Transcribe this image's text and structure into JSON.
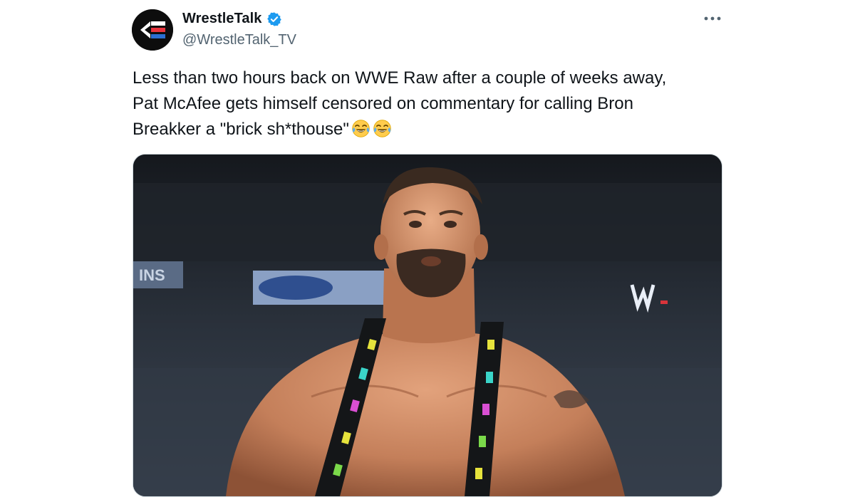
{
  "tweet": {
    "author": {
      "display_name": "WrestleTalk",
      "handle": "@WrestleTalk_TV",
      "verified": true,
      "avatar_icon": "wrestletalk-logo-icon",
      "verified_icon": "verified-badge-icon"
    },
    "more_icon": "more-options-icon",
    "text_lines": [
      "Less than two hours back on WWE Raw after a couple of weeks away,",
      "Pat McAfee gets himself censored on commentary for calling Bron",
      "Breakker a \"brick sh*thouse\""
    ],
    "emojis": [
      "face-with-tears-of-joy-icon",
      "face-with-tears-of-joy-icon"
    ],
    "media": {
      "type": "image",
      "icon": "wrestler-photo",
      "arena_sign_text": "INS"
    }
  },
  "colors": {
    "text_primary": "#0f1419",
    "text_secondary": "#536471",
    "verified_blue": "#1d9bf0",
    "logo_red": "#e8333c",
    "logo_blue": "#2b6fd1"
  }
}
